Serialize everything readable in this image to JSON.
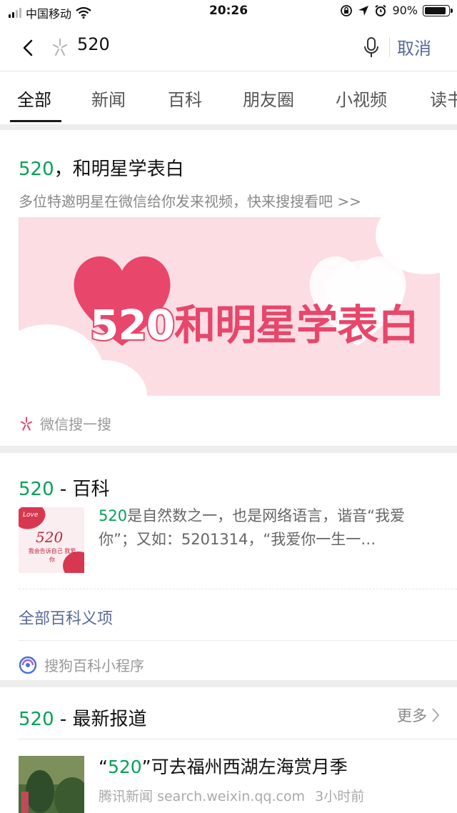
{
  "status_bar": {
    "carrier": "中国移动",
    "time": "20:26",
    "battery_percent": "90%",
    "battery_level": 0.9
  },
  "search": {
    "query": "520",
    "cancel_label": "取消"
  },
  "tabs": [
    {
      "label": "全部",
      "active": true
    },
    {
      "label": "新闻"
    },
    {
      "label": "百科"
    },
    {
      "label": "朋友圈"
    },
    {
      "label": "小视频"
    },
    {
      "label": "读书"
    }
  ],
  "promo_card": {
    "title_highlight": "520",
    "title_rest": "，和明星学表白",
    "subtitle": "多位特邀明星在微信给你发来视频，快来搜搜看吧 >>",
    "banner_number": "520",
    "banner_text": "和明星学表白",
    "source": "微信搜一搜"
  },
  "baike_card": {
    "title_highlight": "520",
    "title_rest": " - 百科",
    "thumb_text": "520",
    "thumb_caption": "我会告诉自己 我爱你",
    "thumb_badge": "Love",
    "desc_highlight": "520",
    "desc_rest": "是自然数之一，也是网络语言，谐音“我爱你”；又如：5201314，“我爱你一生一…",
    "all_entries_label": "全部百科义项",
    "source": "搜狗百科小程序"
  },
  "news_card": {
    "title_highlight": "520",
    "title_rest": " - 最新报道",
    "more_label": "更多",
    "item": {
      "quote_open": "“",
      "title_highlight": "520",
      "title_rest": "”可去福州西湖左海赏月季",
      "source": "腾讯新闻",
      "url": "search.weixin.qq.com",
      "time": "3小时前"
    }
  },
  "colors": {
    "highlight_green": "#07a15a",
    "link_blue": "#576b95",
    "banner_pink": "#e8466b"
  }
}
